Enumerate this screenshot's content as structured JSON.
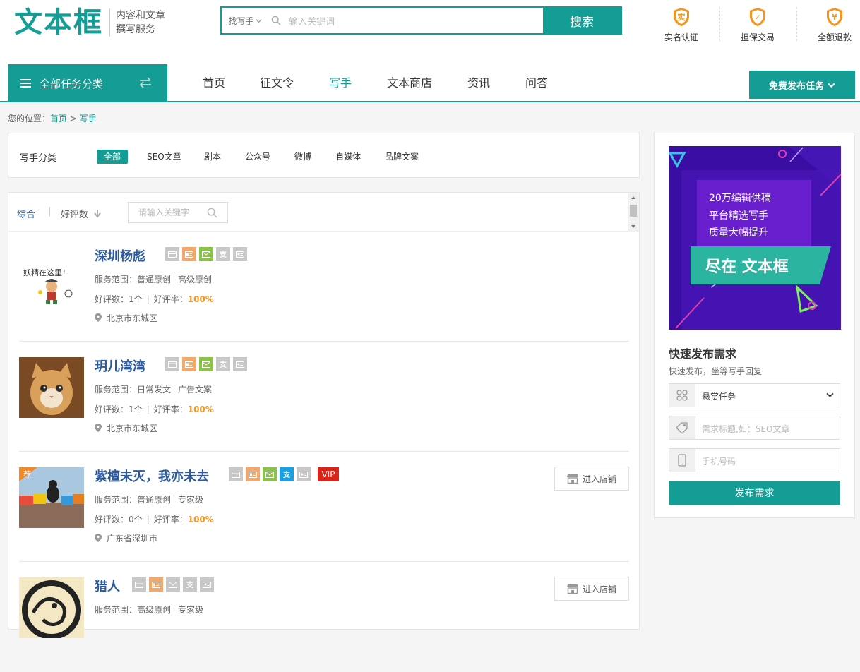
{
  "header": {
    "logo_text": "文本框",
    "logo_sub_line1": "内容和文章",
    "logo_sub_line2": "撰写服务",
    "search": {
      "type_label": "找写手",
      "placeholder": "输入关键词",
      "button": "搜索"
    },
    "trust": [
      {
        "label": "实名认证",
        "glyph": "实",
        "icon": "shield-real-icon"
      },
      {
        "label": "担保交易",
        "glyph": "✓",
        "icon": "shield-check-icon"
      },
      {
        "label": "全额退款",
        "glyph": "¥",
        "icon": "shield-yen-icon"
      }
    ]
  },
  "nav": {
    "category_button": "全部任务分类",
    "items": [
      "首页",
      "征文令",
      "写手",
      "文本商店",
      "资讯",
      "问答"
    ],
    "active": "写手",
    "publish_button": "免费发布任务"
  },
  "breadcrumb": {
    "prefix": "您的位置：",
    "home": "首页",
    "sep": ">",
    "current": "写手"
  },
  "filter": {
    "label": "写手分类",
    "tags": [
      "全部",
      "SEO文章",
      "剧本",
      "公众号",
      "微博",
      "自媒体",
      "品牌文案"
    ]
  },
  "sort": {
    "comprehensive": "综合",
    "sep": "|",
    "by_rating": "好评数",
    "keyword_placeholder": "请输入关键字"
  },
  "writers": [
    {
      "name": "深圳杨彪",
      "scope_label": "服务范围：",
      "scopes": [
        "普通原创",
        "高级原创"
      ],
      "good_label": "好评数：",
      "good_count": "1个",
      "rate_label": "好评率：",
      "rate": "100%",
      "location": "北京市东城区",
      "avatar_text": "妖精在这里！",
      "vip": "",
      "shop": ""
    },
    {
      "name": "玥儿湾湾",
      "scope_label": "服务范围：",
      "scopes": [
        "日常发文",
        "广告文案"
      ],
      "good_label": "好评数：",
      "good_count": "1个",
      "rate_label": "好评率：",
      "rate": "100%",
      "location": "北京市东城区",
      "avatar_text": "",
      "vip": "",
      "shop": ""
    },
    {
      "name": "紫檀未灭，我亦未去",
      "scope_label": "服务范围：",
      "scopes": [
        "普通原创",
        "专家级"
      ],
      "good_label": "好评数：",
      "good_count": "0个",
      "rate_label": "好评率：",
      "rate": "100%",
      "location": "广东省深圳市",
      "avatar_text": "荐",
      "vip": "VIP",
      "shop": "进入店铺"
    },
    {
      "name": "猎人",
      "scope_label": "服务范围：",
      "scopes": [
        "高级原创",
        "专家级"
      ],
      "good_label": "",
      "good_count": "",
      "rate_label": "",
      "rate": "",
      "location": "",
      "avatar_text": "",
      "vip": "",
      "shop": "进入店铺"
    }
  ],
  "sidebar": {
    "banner_lines": [
      "20万编辑供稿",
      "平台精选写手",
      "质量大幅提升"
    ],
    "banner_slogan": "尽在 文本框",
    "quick_title": "快速发布需求",
    "quick_sub": "快速发布，坐等写手回复",
    "select_value": "悬赏任务",
    "title_placeholder": "需求标题,如：SEO文章",
    "phone_placeholder": "手机号码",
    "submit": "发布需求"
  },
  "colors": {
    "brand": "#139d94",
    "link": "#2c5aa0",
    "highlight": "#f7941d",
    "vip": "#d9241a"
  }
}
